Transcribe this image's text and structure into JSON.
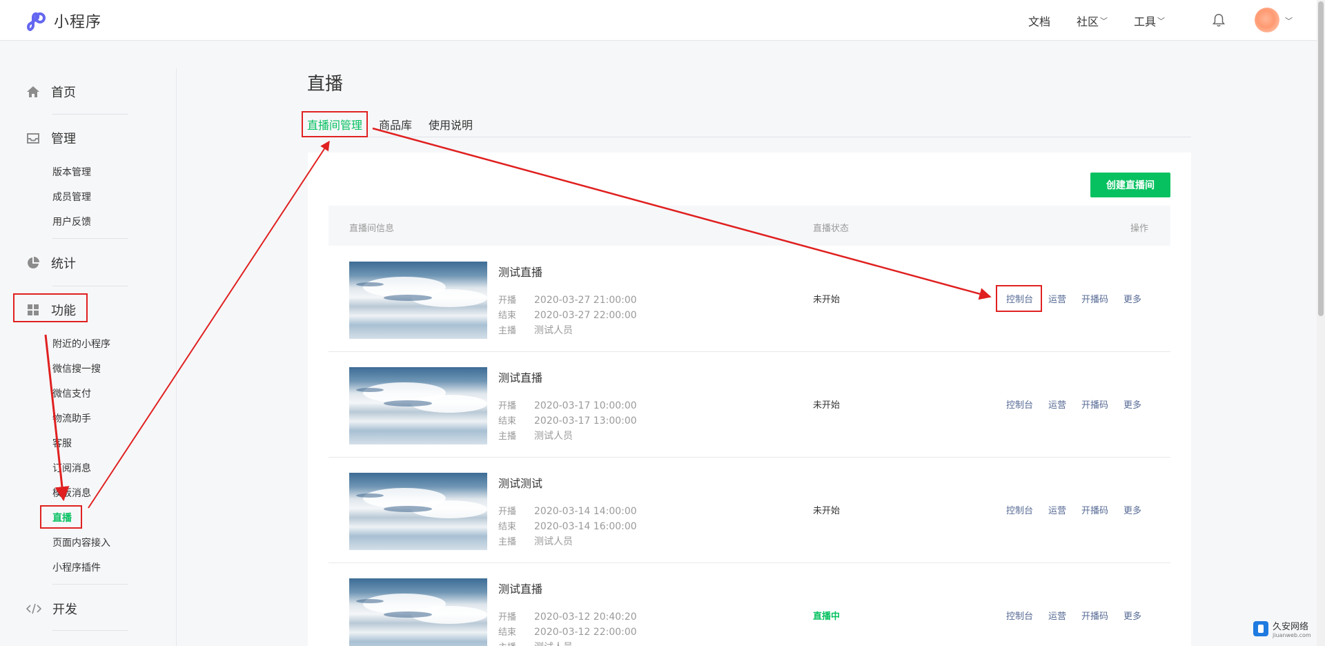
{
  "app": {
    "title": "小程序"
  },
  "topnav": {
    "docs": "文档",
    "community": "社区",
    "tools": "工具"
  },
  "sidebar": {
    "home": "首页",
    "manage": {
      "label": "管理",
      "items": [
        "版本管理",
        "成员管理",
        "用户反馈"
      ]
    },
    "stats": "统计",
    "features": {
      "label": "功能",
      "items": [
        "附近的小程序",
        "微信搜一搜",
        "微信支付",
        "物流助手",
        "客服",
        "订阅消息",
        "模板消息",
        "直播",
        "页面内容接入",
        "小程序插件"
      ]
    },
    "dev": "开发"
  },
  "page": {
    "title": "直播",
    "tabs": [
      "直播间管理",
      "商品库",
      "使用说明"
    ],
    "create_button": "创建直播间",
    "table": {
      "headers": {
        "info": "直播间信息",
        "status": "直播状态",
        "ops": "操作"
      },
      "labels": {
        "start": "开播",
        "end": "结束",
        "host": "主播"
      },
      "ops": [
        "控制台",
        "运营",
        "开播码",
        "更多"
      ],
      "rows": [
        {
          "title": "测试直播",
          "start": "2020-03-27 21:00:00",
          "end": "2020-03-27 22:00:00",
          "host": "测试人员",
          "status": "未开始"
        },
        {
          "title": "测试直播",
          "start": "2020-03-17 10:00:00",
          "end": "2020-03-17 13:00:00",
          "host": "测试人员",
          "status": "未开始"
        },
        {
          "title": "测试测试",
          "start": "2020-03-14 14:00:00",
          "end": "2020-03-14 16:00:00",
          "host": "测试人员",
          "status": "未开始"
        },
        {
          "title": "测试直播",
          "start": "2020-03-12 20:40:20",
          "end": "2020-03-12 22:00:00",
          "host": "测试人员",
          "status": "直播中"
        }
      ]
    }
  },
  "watermark": {
    "main": "久安网络",
    "sub": "jiuanweb.com"
  },
  "colors": {
    "accent": "#07c160",
    "link": "#576b95",
    "annotation": "#e02020"
  }
}
